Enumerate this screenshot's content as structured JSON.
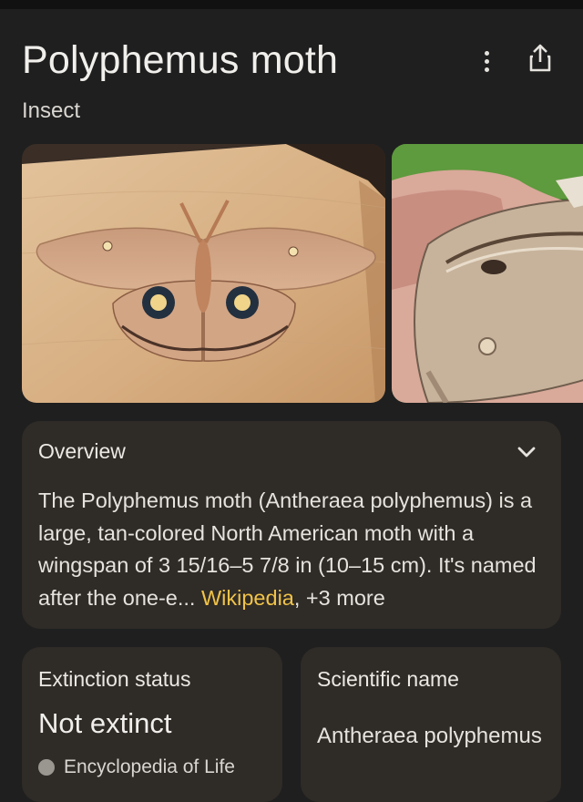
{
  "header": {
    "title": "Polyphemus moth",
    "subtitle": "Insect",
    "more_icon": "more-vert-icon",
    "share_icon": "share-icon"
  },
  "images": [
    {
      "name": "moth-on-wood-photo"
    },
    {
      "name": "moth-on-hand-photo"
    }
  ],
  "overview": {
    "title": "Overview",
    "text": "The Polyphemus moth (Antheraea polyphemus) is a large, tan-colored North American moth with a wingspan of 3 15/16–5 7/8 in (10–15 cm). It's named after the one-e",
    "ellipsis": "...",
    "source_link": "Wikipedia",
    "separator": ",",
    "more_sources": "+3 more"
  },
  "cards": {
    "extinction": {
      "label": "Extinction status",
      "value": "Not extinct",
      "source": "Encyclopedia of Life"
    },
    "scientific": {
      "label": "Scientific name",
      "value": "Antheraea polyphemus"
    }
  },
  "colors": {
    "background": "#1f1f1f",
    "card": "#2f2b27",
    "link": "#f0c348"
  }
}
